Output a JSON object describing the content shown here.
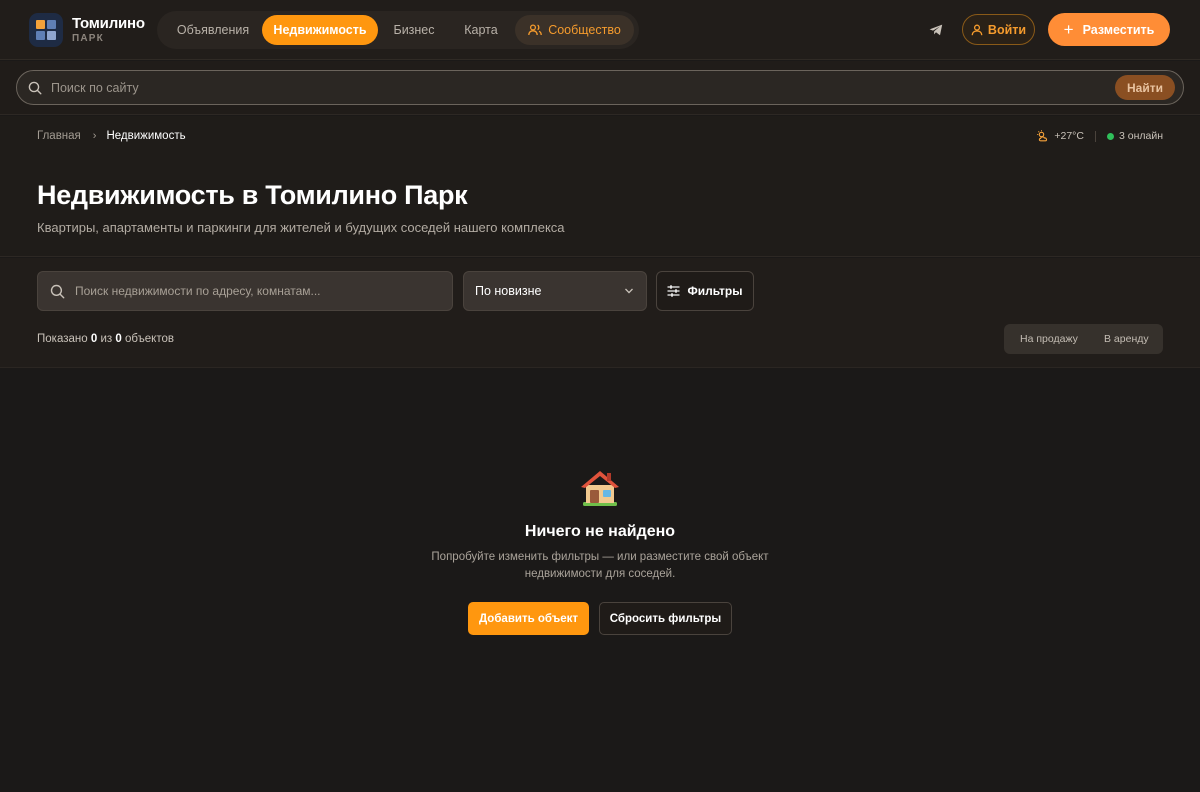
{
  "colors": {
    "background": "#1b1918",
    "accent": "#ff970f",
    "accent_alt": "#ff8d36",
    "online": "#2fbf5a"
  },
  "logo": {
    "title": "Томилино",
    "subtitle": "ПАРК"
  },
  "nav": {
    "items": [
      {
        "label": "Объявления",
        "active": false
      },
      {
        "label": "Недвижимость",
        "active": true
      },
      {
        "label": "Бизнес",
        "active": false
      },
      {
        "label": "Карта",
        "active": false
      },
      {
        "label": "Сообщество",
        "active": false,
        "icon": "users-icon"
      }
    ]
  },
  "header": {
    "telegram_icon": "telegram-icon",
    "login_label": "Войти",
    "post_label": "Разместить"
  },
  "site_search": {
    "placeholder": "Поиск по сайту",
    "value": "",
    "button": "Найти"
  },
  "breadcrumb": {
    "home": "Главная",
    "current": "Недвижимость"
  },
  "status": {
    "weather": "+27°C",
    "online": "3 онлайн"
  },
  "page": {
    "title": "Недвижимость в Томилино Парк",
    "subtitle": "Квартиры, апартаменты и паркинги для жителей и будущих соседей нашего комплекса"
  },
  "filters": {
    "search_placeholder": "Поиск недвижимости по адресу, комнатам...",
    "search_value": "",
    "sort_selected": "По новизне",
    "filters_label": "Фильтры",
    "count": {
      "prefix": "Показано",
      "shown": "0",
      "middle": "из",
      "total": "0",
      "suffix": "объектов"
    },
    "deal_types": [
      "На продажу",
      "В аренду"
    ]
  },
  "empty_state": {
    "icon": "house-icon",
    "title": "Ничего не найдено",
    "text": "Попробуйте изменить фильтры — или разместите свой объект недвижимости для соседей.",
    "add_label": "Добавить объект",
    "reset_label": "Сбросить фильтры"
  }
}
